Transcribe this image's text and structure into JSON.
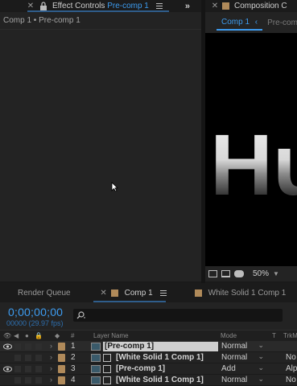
{
  "effect_controls": {
    "tab_title": "Effect Controls",
    "tab_target": "Pre-comp 1",
    "breadcrumb": "Comp 1 • Pre-comp 1"
  },
  "composition": {
    "tab_title": "Composition C",
    "tabs": [
      "Comp 1",
      "Pre-comp"
    ],
    "viewer_text": "Hu",
    "zoom": "50%"
  },
  "timeline": {
    "tabs": [
      "Render Queue",
      "Comp 1",
      "White Solid 1 Comp 1"
    ],
    "timecode": "0;00;00;00",
    "fps": "00000 (29.97 fps)",
    "header": {
      "layer_name": "Layer Name",
      "mode": "Mode",
      "t": "T",
      "trkmat": "TrkM"
    },
    "layers": [
      {
        "num": "1",
        "name": "[Pre-comp 1]",
        "mode": "Normal",
        "trkmat": "",
        "selected": true,
        "eye": true
      },
      {
        "num": "2",
        "name": "[White Solid 1 Comp 1]",
        "mode": "Normal",
        "trkmat": "No",
        "selected": false,
        "eye": false
      },
      {
        "num": "3",
        "name": "[Pre-comp 1]",
        "mode": "Add",
        "trkmat": "Alp",
        "selected": false,
        "eye": true
      },
      {
        "num": "4",
        "name": "[White Solid 1 Comp 1]",
        "mode": "Normal",
        "trkmat": "No",
        "selected": false,
        "eye": false
      }
    ]
  },
  "colors": {
    "accent": "#3d9cf0",
    "label": "#b08a5a",
    "panel": "#232323"
  }
}
